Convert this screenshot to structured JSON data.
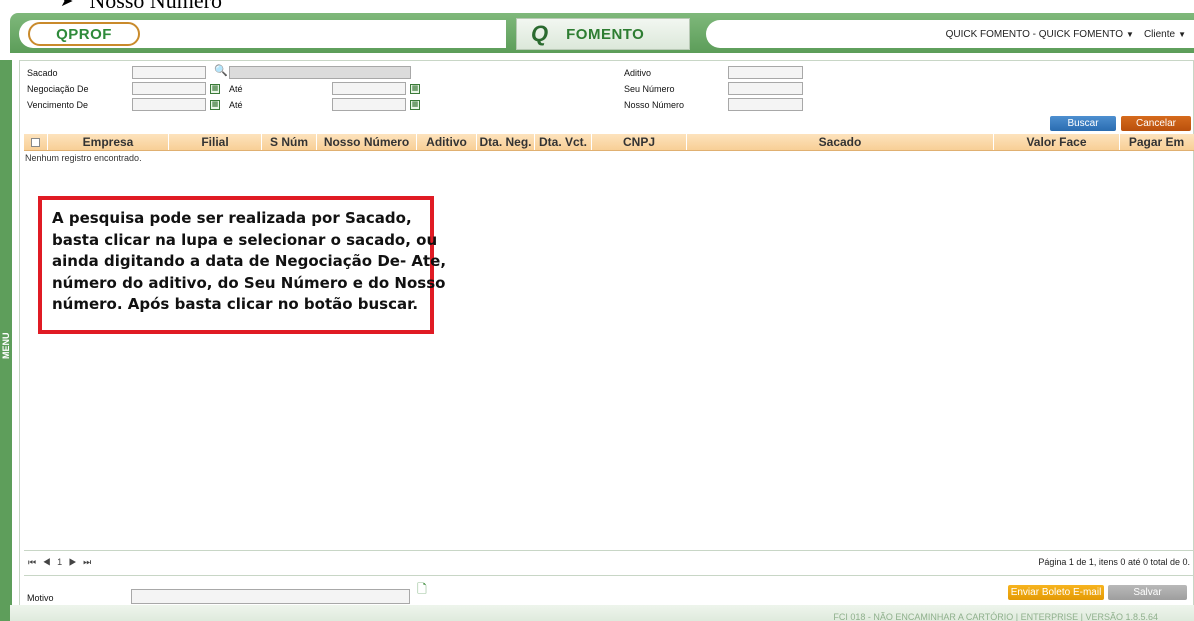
{
  "doc_heading": {
    "bullet": "➤",
    "text": "Nosso Número"
  },
  "header": {
    "logo_text": "QPROF",
    "module_symbol": "Q",
    "module_name": "FOMENTO",
    "company_menu": "QUICK FOMENTO - QUICK FOMENTO",
    "user_menu": "Cliente",
    "caret": "▼"
  },
  "sidebar": {
    "menu_label": "MENU"
  },
  "filters": {
    "sacado_label": "Sacado",
    "negociacao_label": "Negociação De",
    "vencimento_label": "Vencimento De",
    "ate_label": "Até",
    "aditivo_label": "Aditivo",
    "seu_numero_label": "Seu Número",
    "nosso_numero_label": "Nosso Número"
  },
  "buttons": {
    "buscar": "Buscar",
    "cancelar": "Cancelar",
    "enviar_boleto": "Enviar Boleto E-mail",
    "salvar": "Salvar"
  },
  "table": {
    "columns": [
      "Empresa",
      "Filial",
      "S Núm",
      "Nosso Número",
      "Aditivo",
      "Dta. Neg.",
      "Dta. Vct.",
      "CNPJ",
      "Sacado",
      "Valor Face",
      "Pagar Em"
    ],
    "empty_message": "Nenhum registro encontrado."
  },
  "callout": {
    "lines": [
      "A pesquisa pode ser realizada por Sacado,",
      "basta clicar na lupa e selecionar o sacado, ou",
      "ainda digitando a data de Negociação De- Ate,",
      "número do aditivo, do Seu Número e do Nosso",
      "número. Após basta clicar no botão buscar."
    ]
  },
  "pager": {
    "controls": "⏮ ◀ 1 ▶ ⏭",
    "info": "Página 1 de 1, itens 0 até 0 total de 0."
  },
  "motivo_label": "Motivo",
  "footer": "FCI 018 - NÃO ENCAMINHAR A CARTÓRIO | ENTERPRISE | VERSÃO 1.8.5.64"
}
